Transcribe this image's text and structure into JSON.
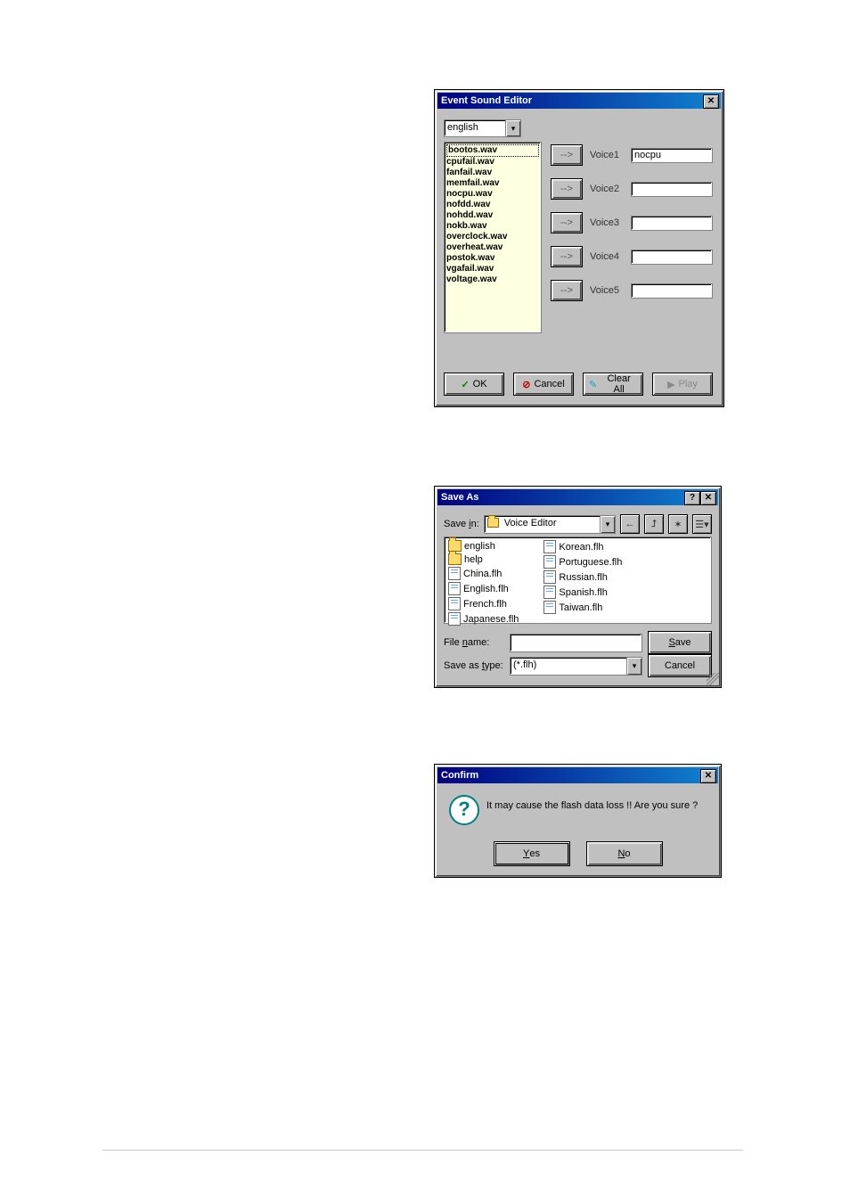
{
  "eventSoundEditor": {
    "title": "Event Sound Editor",
    "language": "english",
    "list": [
      "bootos.wav",
      "cpufail.wav",
      "fanfail.wav",
      "memfail.wav",
      "nocpu.wav",
      "nofdd.wav",
      "nohdd.wav",
      "nokb.wav",
      "overclock.wav",
      "overheat.wav",
      "postok.wav",
      "vgafail.wav",
      "voltage.wav"
    ],
    "selectedIndex": 0,
    "voices": [
      {
        "label": "Voice1",
        "value": "nocpu"
      },
      {
        "label": "Voice2",
        "value": ""
      },
      {
        "label": "Voice3",
        "value": ""
      },
      {
        "label": "Voice4",
        "value": ""
      },
      {
        "label": "Voice5",
        "value": ""
      }
    ],
    "arrowGlyph": "-->",
    "buttons": {
      "ok": "OK",
      "cancel": "Cancel",
      "clearAll": "Clear All",
      "play": "Play"
    }
  },
  "saveAs": {
    "title": "Save As",
    "saveInLabel": "Save in:",
    "saveInValue": "Voice Editor",
    "toolbarIcons": [
      "back-icon",
      "up-folder-icon",
      "new-folder-icon",
      "view-icon"
    ],
    "filesCol1": [
      {
        "name": "english",
        "type": "folder"
      },
      {
        "name": "help",
        "type": "folder"
      },
      {
        "name": "China.flh",
        "type": "file"
      },
      {
        "name": "English.flh",
        "type": "file"
      },
      {
        "name": "French.flh",
        "type": "file"
      },
      {
        "name": "Japanese.flh",
        "type": "file"
      }
    ],
    "filesCol2": [
      {
        "name": "Korean.flh",
        "type": "file"
      },
      {
        "name": "Portuguese.flh",
        "type": "file"
      },
      {
        "name": "Russian.flh",
        "type": "file"
      },
      {
        "name": "Spanish.flh",
        "type": "file"
      },
      {
        "name": "Taiwan.flh",
        "type": "file"
      }
    ],
    "fileNameLabel": "File name:",
    "fileNameValue": "",
    "saveTypeLabel": "Save as type:",
    "saveTypeValue": "(*.flh)",
    "saveBtn": "Save",
    "cancelBtn": "Cancel"
  },
  "confirm": {
    "title": "Confirm",
    "message": "It may cause the flash data loss !!  Are you sure ?",
    "yes": "Yes",
    "no": "No"
  }
}
